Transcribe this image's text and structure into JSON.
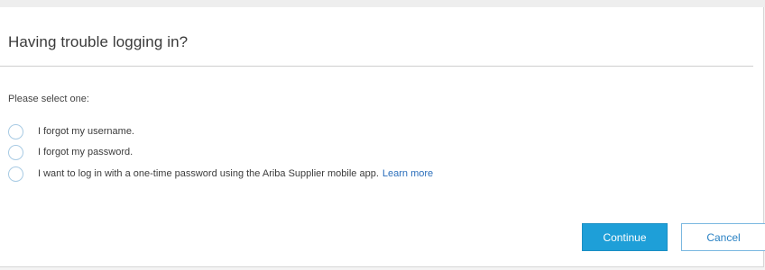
{
  "dialog": {
    "title": "Having trouble logging in?",
    "prompt": "Please select one:",
    "options": [
      {
        "label": "I forgot my username."
      },
      {
        "label": "I forgot my password."
      },
      {
        "label": "I want to log in with a one-time password using the Ariba Supplier mobile app.",
        "link_label": "Learn more"
      }
    ],
    "buttons": {
      "continue_label": "Continue",
      "cancel_label": "Cancel"
    }
  },
  "colors": {
    "primary_button": "#1e9fd8",
    "link": "#2a6ebb",
    "radio_border": "#a8cbe4"
  }
}
